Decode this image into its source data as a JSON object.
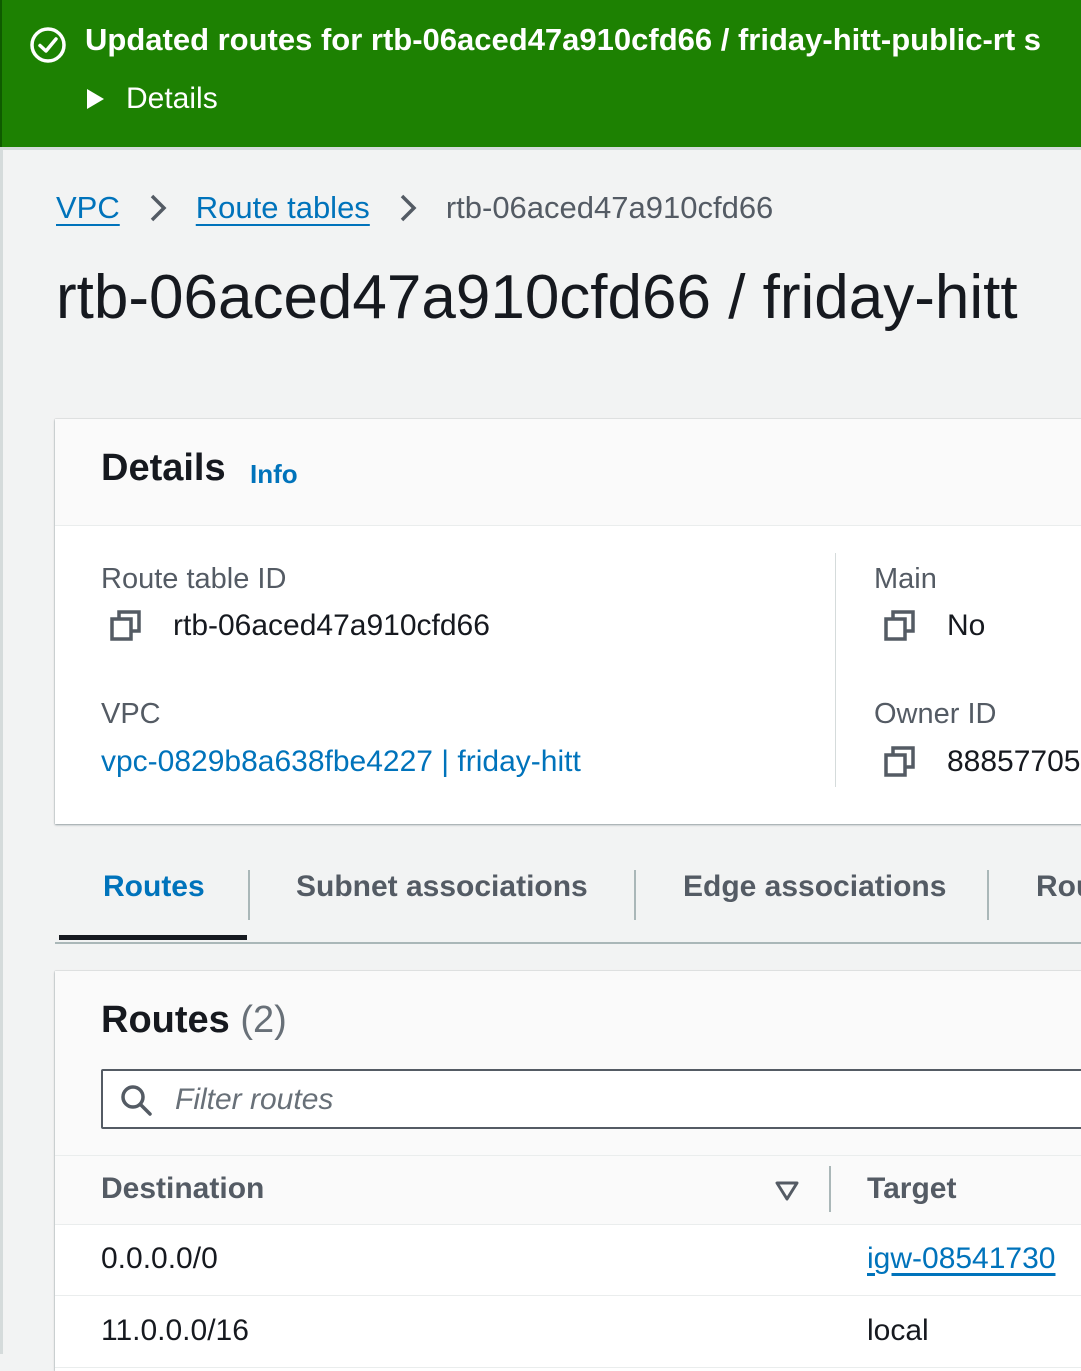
{
  "flash": {
    "message": "Updated routes for rtb-06aced47a910cfd66 / friday-hitt-public-rt s",
    "details_label": "Details",
    "color": "#1d8102"
  },
  "breadcrumb": {
    "items": [
      "VPC",
      "Route tables"
    ],
    "current": "rtb-06aced47a910cfd66"
  },
  "page_title": "rtb-06aced47a910cfd66 / friday-hitt",
  "details": {
    "title": "Details",
    "info_label": "Info",
    "route_table_id_label": "Route table ID",
    "route_table_id": "rtb-06aced47a910cfd66",
    "main_label": "Main",
    "main_value": "No",
    "vpc_label": "VPC",
    "vpc_value": "vpc-0829b8a638fbe4227 | friday-hitt",
    "owner_label": "Owner ID",
    "owner_value": "88857705"
  },
  "tabs": [
    "Routes",
    "Subnet associations",
    "Edge associations",
    "Rou"
  ],
  "routes": {
    "title": "Routes",
    "count": "(2)",
    "filter_placeholder": "Filter routes",
    "columns": [
      "Destination",
      "Target"
    ],
    "rows": [
      {
        "destination": "0.0.0.0/0",
        "target": "igw-08541730"
      },
      {
        "destination": "11.0.0.0/16",
        "target": "local"
      }
    ]
  },
  "colors": {
    "accent": "#0073bb",
    "success": "#1d8102",
    "text": "#16191f",
    "muted": "#545b64"
  }
}
